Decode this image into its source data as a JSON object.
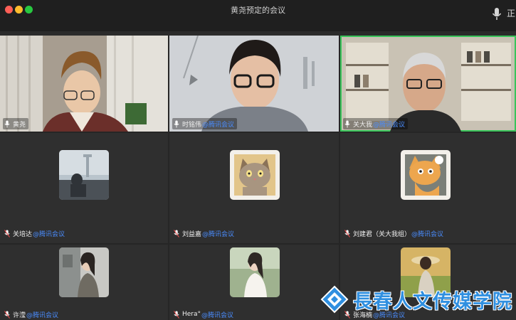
{
  "window": {
    "title": "黄尧预定的会议",
    "right_label_fragment": "正"
  },
  "brand_suffix": "@腾讯会议",
  "participants": [
    {
      "name": "黄尧",
      "type": "video",
      "mic": "on"
    },
    {
      "name": "时铭伟",
      "type": "video",
      "mic": "on",
      "brand": "@腾讯会议"
    },
    {
      "name": "关大我",
      "type": "video",
      "mic": "on",
      "brand": "@腾讯会议",
      "active_speaker": true
    },
    {
      "name": "关培达",
      "type": "avatar",
      "mic": "muted",
      "brand": "@腾讯会议",
      "avatar_icon": "photo-person-icon"
    },
    {
      "name": "刘益嘉",
      "type": "avatar",
      "mic": "muted",
      "brand": "@腾讯会议",
      "avatar_icon": "cartoon-cat-icon"
    },
    {
      "name": "刘建君（关大我组）",
      "type": "avatar",
      "mic": "muted",
      "brand": "@腾讯会议",
      "avatar_icon": "cartoon-cat-icon"
    },
    {
      "name": "许滢",
      "type": "avatar",
      "mic": "muted",
      "brand": "@腾讯会议",
      "avatar_icon": "photo-person-icon"
    },
    {
      "name": "Hera°",
      "type": "avatar",
      "mic": "muted",
      "brand": "@腾讯会议",
      "avatar_icon": "photo-person-icon"
    },
    {
      "name": "张海楠",
      "type": "avatar",
      "mic": "muted",
      "brand": "@腾讯会议",
      "avatar_icon": "photo-person-icon"
    }
  ],
  "watermark": {
    "text": "長春人文传媒学院"
  },
  "colors": {
    "active_border": "#39c45a",
    "brand_blue": "#4a8dff",
    "watermark_blue": "#2f8fe0"
  }
}
